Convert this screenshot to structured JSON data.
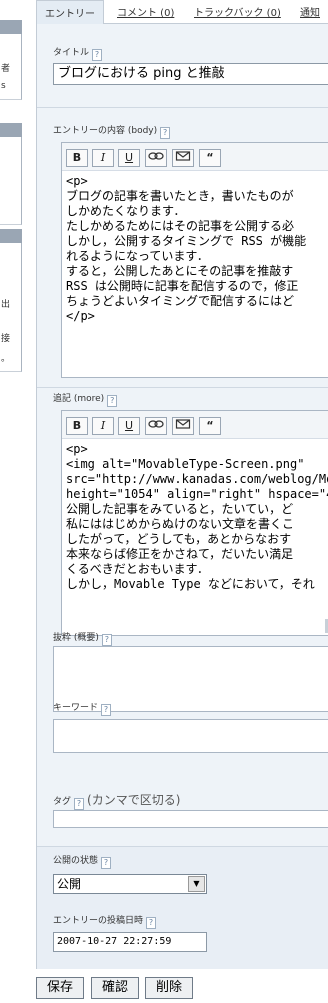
{
  "sidebar": {
    "items": [
      "者",
      "s",
      "出",
      "接",
      "。"
    ]
  },
  "tabs": [
    {
      "label": "エントリー",
      "active": true
    },
    {
      "label": "コメント (0)",
      "active": false
    },
    {
      "label": "トラックバック (0)",
      "active": false
    },
    {
      "label": "通知",
      "active": false
    }
  ],
  "hint_icon": "?",
  "title_field": {
    "label": "タイトル",
    "value": "ブログにおける ping と推敲"
  },
  "body_field": {
    "label": "エントリーの内容 (body)",
    "lines": [
      "<p>",
      "ブログの記事を書いたとき，書いたものが",
      "しかめたくなります．",
      "たしかめるためにはその記事を公開する必",
      "しかし，公開するタイミングで RSS が機能",
      "れるようになっています．",
      "すると，公開したあとにその記事を推敲す",
      "RSS は公開時に記事を配信するので，修正",
      "ちょうどよいタイミングで配信するにはど",
      "</p>"
    ]
  },
  "more_field": {
    "label": "追記 (more)",
    "lines": [
      "<p>",
      "<img alt=\"MovableType-Screen.png\"",
      "src=\"http://www.kanadas.com/weblog/Mov",
      "height=\"1054\" align=\"right\" hspace=\"4\"",
      "公開した記事をみていると，たいてい，ど",
      "私にははじめからぬけのない文章を書くこ",
      "したがって，どうしても，あとからなおす",
      "本来ならば修正をかさねて，だいたい満足",
      "くるべきだとおもいます．",
      "しかし，Movable Type などにおいて，それ"
    ]
  },
  "toolbar": {
    "bold": "B",
    "italic": "I",
    "underline": "U",
    "link_icon": "link-icon",
    "email_icon": "email-icon",
    "quote": "“"
  },
  "excerpt_field": {
    "label": "抜粋 (概要)"
  },
  "keywords_field": {
    "label": "キーワード"
  },
  "tags_field": {
    "label": "タグ",
    "note": "(カンマで区切る)"
  },
  "status_field": {
    "label": "公開の状態",
    "value": "公開"
  },
  "date_field": {
    "label": "エントリーの投稿日時",
    "value": "2007-10-27 22:27:59"
  },
  "buttons": {
    "save": "保存",
    "preview": "確認",
    "delete": "削除"
  },
  "colors": {
    "panel": "#eef3f8",
    "border": "#aab6c4",
    "sidebar_band": "#9aa6b4"
  }
}
